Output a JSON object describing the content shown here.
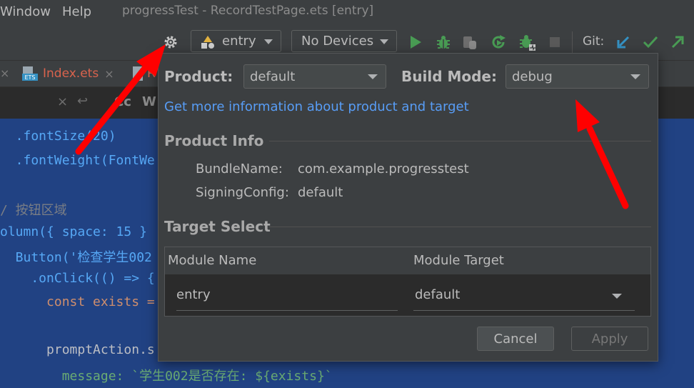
{
  "menu": {
    "window": "Window",
    "help": "Help"
  },
  "window_title": "progressTest - RecordTestPage.ets [entry]",
  "toolbar": {
    "module_combo": "entry",
    "device_combo": "No Devices",
    "git_label": "Git:"
  },
  "tabs": [
    {
      "label": "Index.ets",
      "badge": "ETS"
    },
    {
      "label": "R"
    }
  ],
  "editor_subbar": {
    "match_case": "Cc",
    "words": "W"
  },
  "code": {
    "line1": "  .fontSize(20)",
    "line2": "  .fontWeight(FontWe",
    "line3": "/ 按钮区域",
    "line4": "olumn({ space: 15 }",
    "line5": "  Button('检查学生002",
    "line6": "    .onClick(() => {",
    "line7": "      const exists =",
    "line8": "      promptAction.s",
    "line9": "        message: `学生002是否存在: ${exists}`"
  },
  "dialog": {
    "product_label": "Product:",
    "product_value": "default",
    "build_mode_label": "Build Mode:",
    "build_mode_value": "debug",
    "info_link": "Get more information about product and target",
    "product_info_title": "Product Info",
    "bundle_name_key": "BundleName:",
    "bundle_name_value": "com.example.progresstest",
    "signing_config_key": "SigningConfig:",
    "signing_config_value": "default",
    "target_select_title": "Target Select",
    "table": {
      "col_module_name": "Module Name",
      "col_module_target": "Module Target",
      "row_module_name": "entry",
      "row_module_target": "default"
    },
    "cancel_button": "Cancel",
    "apply_button": "Apply"
  },
  "colors": {
    "accent_link": "#589df6",
    "run_green": "#499c54",
    "annotation_red": "#ff0000",
    "code_selection_bg": "#214283"
  },
  "icons": [
    "settings-gear-icon",
    "run-icon",
    "debug-bug-icon",
    "attach-debugger-icon",
    "rerun-icon",
    "profile-bug-icon",
    "stop-icon",
    "git-update-icon",
    "git-commit-icon",
    "git-push-icon"
  ]
}
